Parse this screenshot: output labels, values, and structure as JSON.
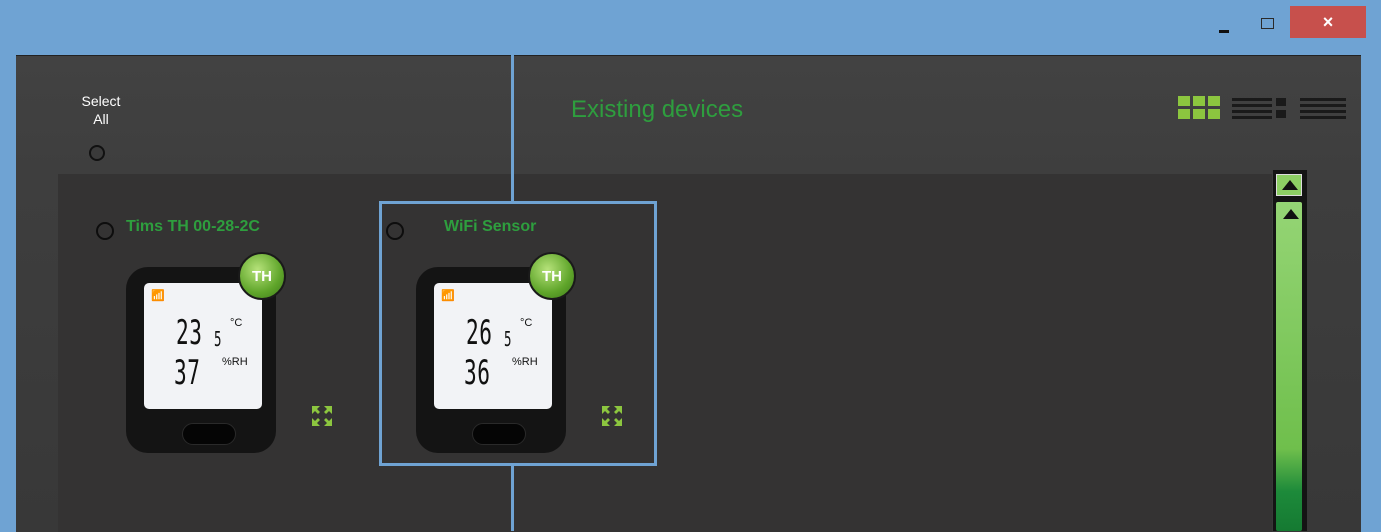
{
  "window": {
    "title": "",
    "minimize_label": "",
    "maximize_label": "",
    "close_label": "×"
  },
  "header": {
    "select_all_label": "Select\nAll",
    "title": "Existing devices",
    "views": [
      "grid-view-icon",
      "detail-view-icon",
      "list-view-icon"
    ]
  },
  "devices": [
    {
      "name": "Tims TH 00-28-2C",
      "type_badge": "TH",
      "temp_main": "23",
      "temp_decimal": "5",
      "temp_unit": "°C",
      "humidity": "37",
      "humidity_unit": "%RH",
      "selected": false
    },
    {
      "name": "WiFi Sensor",
      "type_badge": "TH",
      "temp_main": "26",
      "temp_decimal": "5",
      "temp_unit": "°C",
      "humidity": "36",
      "humidity_unit": "%RH",
      "selected": false
    }
  ],
  "colors": {
    "accent_green": "#2e9e3e",
    "window_blue": "#6fa3d3",
    "close_red": "#c7504c",
    "panel_bg": "#343333"
  }
}
